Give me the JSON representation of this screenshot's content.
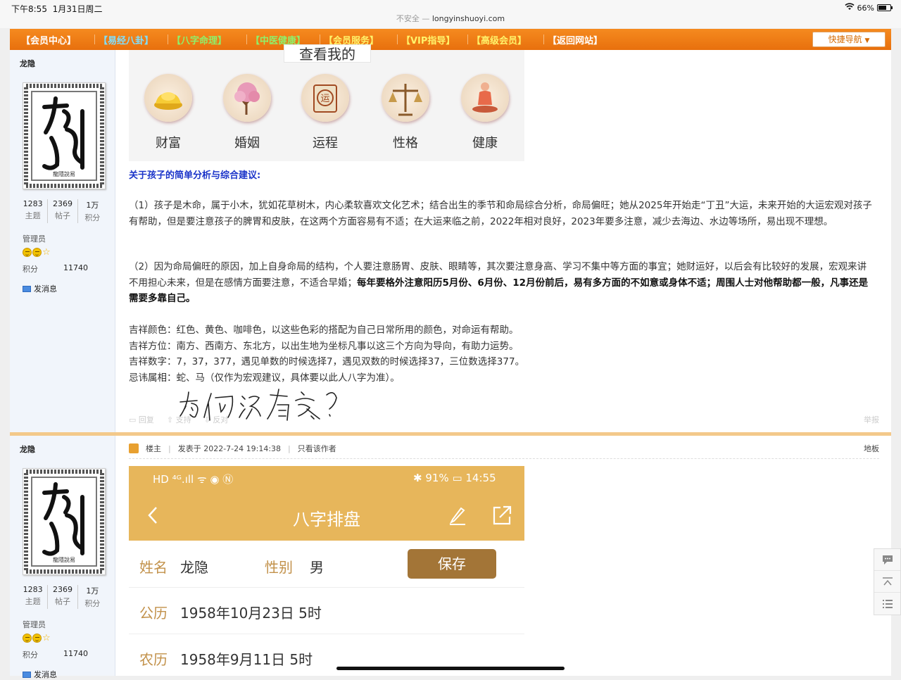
{
  "status_bar": {
    "time": "下午8:55",
    "date": "1月31日周二",
    "insecure": "不安全 —",
    "url": "longyinshuoyi.com",
    "battery_text": "66%",
    "battery_level": 0.66
  },
  "nav": {
    "items": [
      {
        "label": "【会员中心】",
        "color": "#ffffff"
      },
      {
        "label": "【易经八卦】",
        "color": "#7fe0ff"
      },
      {
        "label": "【八字命理】",
        "color": "#8ff06a"
      },
      {
        "label": "【中医健康】",
        "color": "#8ff06a"
      },
      {
        "label": "【会员服务】",
        "color": "#fff36a"
      },
      {
        "label": "【VIP指导】",
        "color": "#fff36a"
      },
      {
        "label": "【高级会员】",
        "color": "#fff36a"
      },
      {
        "label": "【返回网站】",
        "color": "#ffffff"
      }
    ],
    "quick_nav": "快捷导航"
  },
  "user": {
    "name": "龙隐",
    "stats": [
      {
        "num": "1283",
        "lbl": "主题"
      },
      {
        "num": "2369",
        "lbl": "帖子"
      },
      {
        "num": "1万",
        "lbl": "积分"
      }
    ],
    "role": "管理员",
    "score_label": "积分",
    "score_value": "11740",
    "message": "发消息"
  },
  "banner": {
    "title": "查看我的",
    "items": [
      {
        "label": "财富",
        "icon": "gold-ingot-icon"
      },
      {
        "label": "婚姻",
        "icon": "blossom-tree-icon"
      },
      {
        "label": "运程",
        "icon": "scroll-icon"
      },
      {
        "label": "性格",
        "icon": "scales-icon"
      },
      {
        "label": "健康",
        "icon": "meditation-icon"
      }
    ],
    "scroll_char": "运"
  },
  "post1": {
    "heading": "关于孩子的简单分析与综合建议:",
    "para1": "（1）孩子是木命，属于小木，犹如花草树木，内心柔软喜欢文化艺术；结合出生的季节和命局综合分析，命局偏旺；她从2025年开始走“丁丑”大运，未来开始的大运宏观对孩子有帮助，但是要注意孩子的脾胃和皮肤，在这两个方面容易有不适；在大运来临之前，2022年相对良好，2023年要多注意，减少去海边、水边等场所，易出现不理想。",
    "para2_normal": "（2）因为命局偏旺的原因，加上自身命局的结构，个人要注意肠胃、皮肤、眼睛等，其次要注意身高、学习不集中等方面的事宜；她财运好，以后会有比较好的发展，宏观来讲不用担心未来，但是在感情方面要注意，不适合早婚；",
    "para2_bold": "每年要格外注意阳历5月份、6月份、12月份前后，易有多方面的不如意或身体不适；周围人士对他帮助都一般，凡事还是需要多靠自己。",
    "lucky": [
      "吉祥颜色：红色、黄色、咖啡色，以这些色彩的搭配为自己日常所用的颜色，对命运有帮助。",
      "吉祥方位：南方、西南方、东北方，以出生地为坐标凡事以这三个方向为导向，有助力运势。",
      "吉祥数字：7，37，377，遇见单数的时候选择7，遇见双数的时候选择37，三位数选择377。",
      "忌讳属相：蛇、马（仅作为宏观建议，具体要以此人八字为准）。"
    ],
    "handwriting": "为何没有兔？",
    "actions": {
      "reply": "回复",
      "support": "支持",
      "oppose": "反对",
      "report": "举报"
    }
  },
  "post2": {
    "op": "楼主",
    "posted": "发表于 2022-7-24 19:14:38",
    "only_author": "只看该作者",
    "floor": "地板"
  },
  "phone": {
    "status_left": "HD ⁴ᴳ.ıll ᯤ ◉ Ⓝ",
    "status_right": "✱ 91% ▭ 14:55",
    "title": "八字排盘",
    "name_label": "姓名",
    "name_value": "龙隐",
    "gender_label": "性别",
    "gender_value": "男",
    "save": "保存",
    "solar_label": "公历",
    "solar_value": "1958年10月23日 5时",
    "lunar_label": "农历",
    "lunar_value": "1958年9月11日 5时"
  }
}
